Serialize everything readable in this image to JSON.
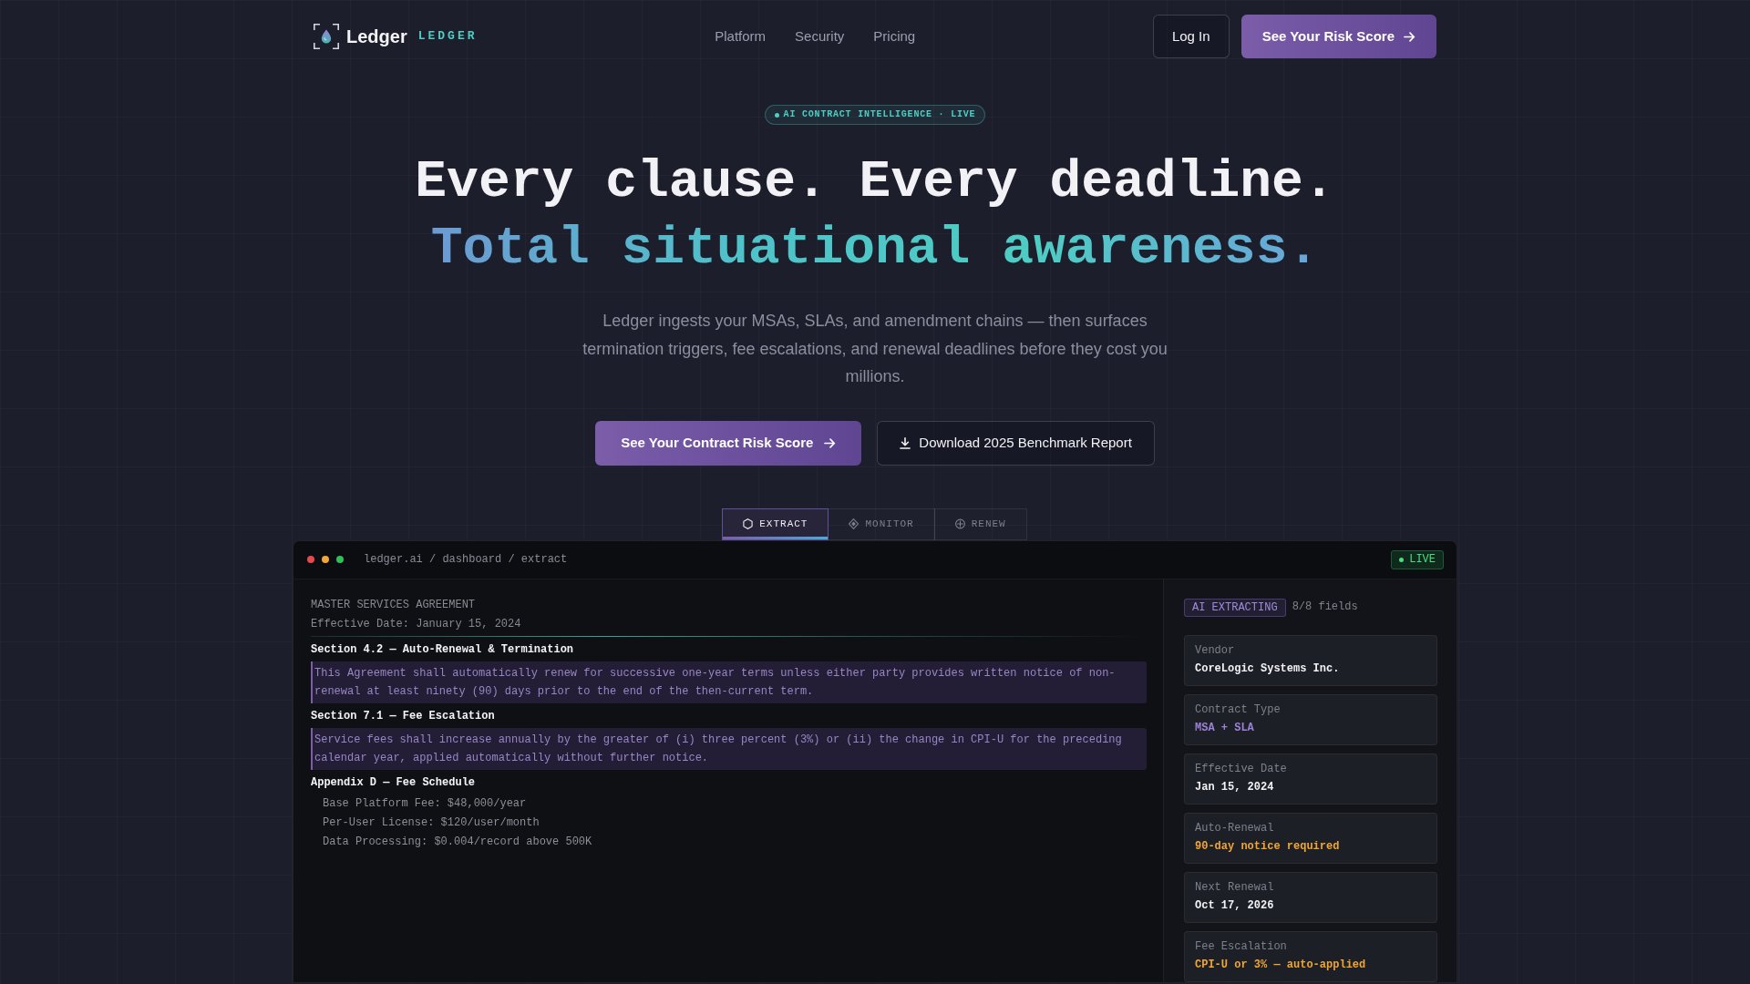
{
  "nav": {
    "brand": "Ledger",
    "brand_tag": "LEDGER",
    "links": [
      "Platform",
      "Security",
      "Pricing"
    ],
    "login": "Log In",
    "cta": "See Your Risk Score"
  },
  "hero": {
    "badge": "AI CONTRACT INTELLIGENCE · LIVE",
    "headline": "Every clause. Every deadline.",
    "headline_accent": "Total situational awareness.",
    "lead": "Ledger ingests your MSAs, SLAs, and amendment chains — then surfaces termination triggers, fee escalations, and renewal deadlines before they cost you millions.",
    "primary_button": "See Your Contract Risk Score",
    "secondary_button": "Download 2025 Benchmark Report"
  },
  "tabs": [
    {
      "label": "EXTRACT",
      "selected": true
    },
    {
      "label": "MONITOR",
      "selected": false
    },
    {
      "label": "RENEW",
      "selected": false
    }
  ],
  "dashboard": {
    "path": "ledger.ai / dashboard / extract",
    "status": "LIVE",
    "document": {
      "title": "MASTER SERVICES AGREEMENT",
      "effective": "Effective Date: January 15, 2024",
      "sections": [
        {
          "heading": "Section 4.2 — Auto-Renewal & Termination",
          "lines": [
            {
              "kind": "clause",
              "text": "This Agreement shall automatically renew for successive one-year terms unless either party provides written notice of non-renewal at least ninety (90) days prior to the end of the then-current term."
            }
          ]
        },
        {
          "heading": "Section 7.1 — Fee Escalation",
          "lines": [
            {
              "kind": "clause",
              "text": "Service fees shall increase annually by the greater of (i) three percent (3%) or (ii) the change in CPI-U for the preceding calendar year, applied automatically without further notice."
            }
          ]
        },
        {
          "heading": "Appendix D — Fee Schedule",
          "lines": [
            {
              "kind": "item",
              "text": "Base Platform Fee: $48,000/year"
            },
            {
              "kind": "item",
              "text": "Per-User License: $120/user/month"
            },
            {
              "kind": "item",
              "text": "Data Processing: $0.004/record above 500K"
            }
          ]
        }
      ]
    },
    "extraction": {
      "status": "AI EXTRACTING",
      "count": "8/8 fields",
      "fields": [
        {
          "label": "Vendor",
          "value": "CoreLogic Systems Inc.",
          "color": "#f2f2f5"
        },
        {
          "label": "Contract Type",
          "value": "MSA + SLA",
          "color": "#9d80d8"
        },
        {
          "label": "Effective Date",
          "value": "Jan 15, 2024",
          "color": "#f2f2f5"
        },
        {
          "label": "Auto-Renewal",
          "value": "90-day notice required",
          "color": "#f0a534"
        },
        {
          "label": "Next Renewal",
          "value": "Oct 17, 2026",
          "color": "#f2f2f5"
        },
        {
          "label": "Fee Escalation",
          "value": "CPI-U or 3% — auto-applied",
          "color": "#f0a534"
        }
      ]
    }
  }
}
